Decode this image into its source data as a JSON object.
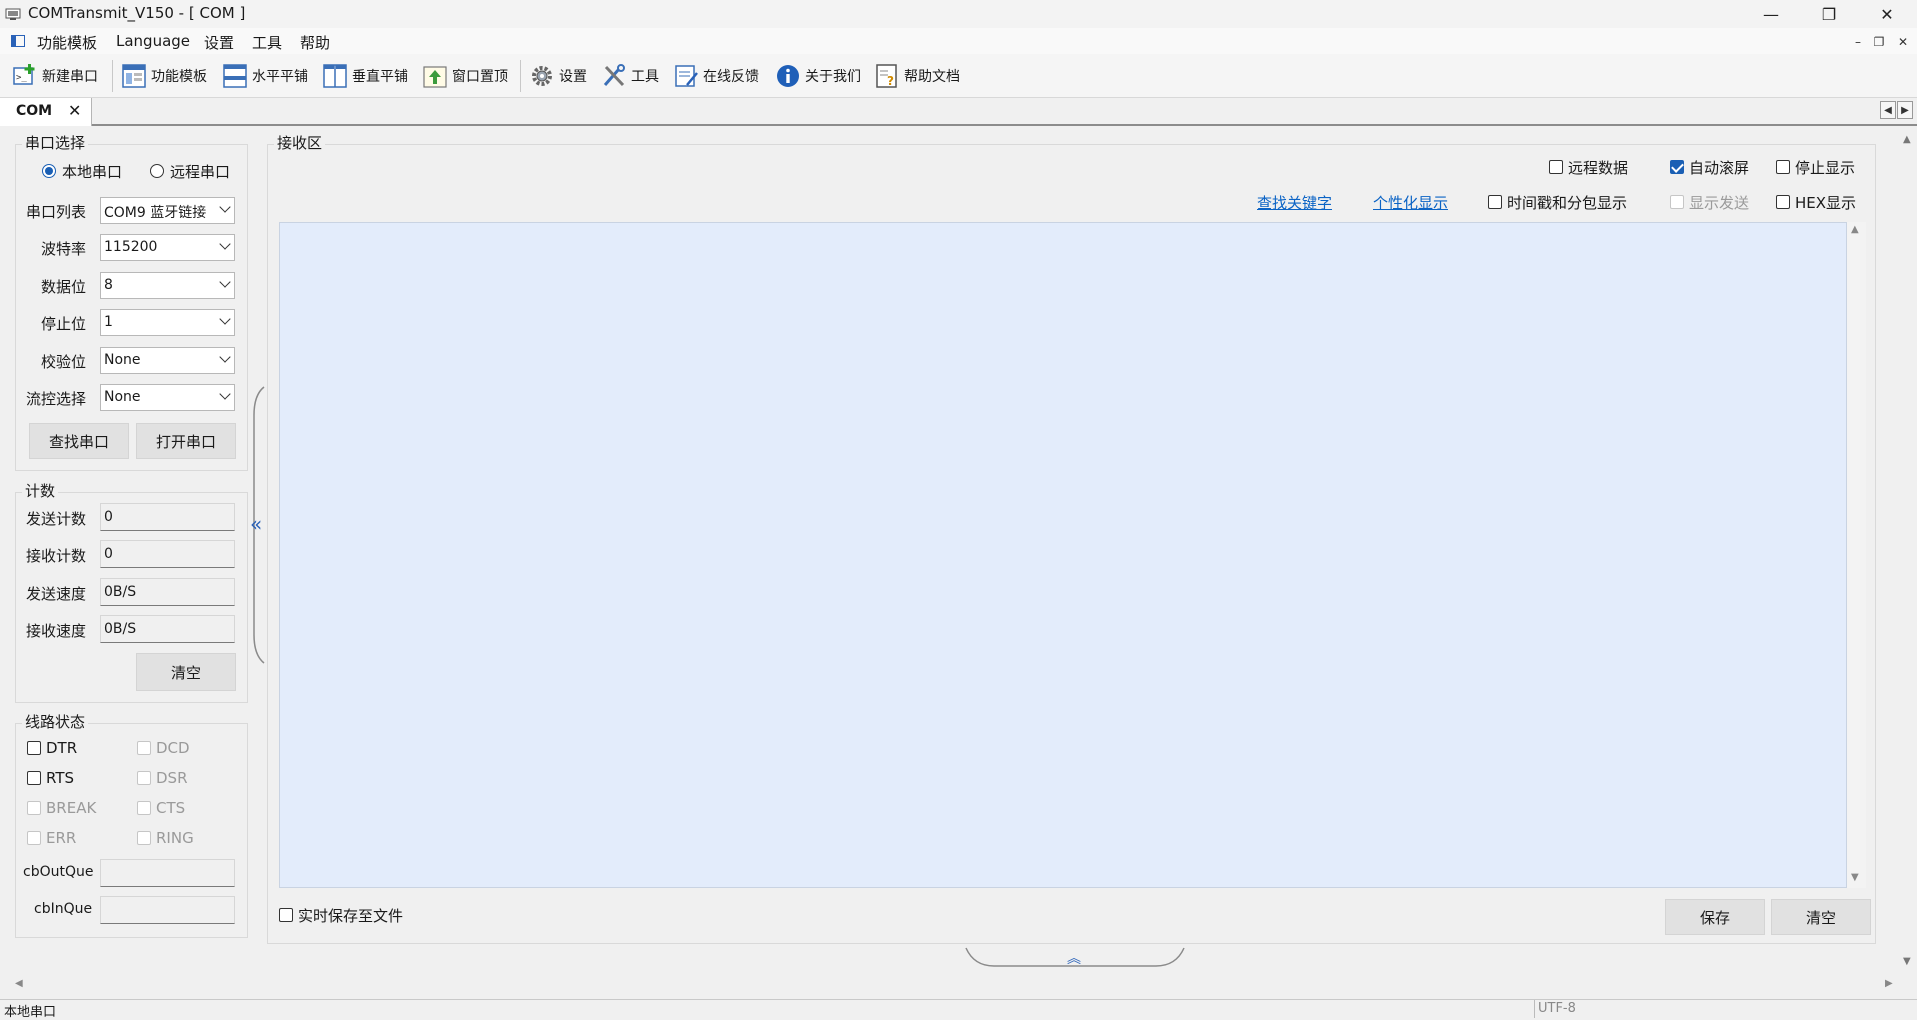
{
  "window": {
    "title": "COMTransmit_V150 - [  COM  ]"
  },
  "menu": [
    "功能模板",
    "Language",
    "设置",
    "工具",
    "帮助"
  ],
  "toolbar": [
    "新建串口",
    "功能模板",
    "水平平铺",
    "垂直平铺",
    "窗口置顶",
    "设置",
    "工具",
    "在线反馈",
    "关于我们",
    "帮助文档"
  ],
  "tab": {
    "label": "COM"
  },
  "serial": {
    "group_title": "串口选择",
    "radio_local": "本地串口",
    "radio_remote": "远程串口",
    "port_label": "串口列表",
    "port_value": "COM9  蓝牙链接",
    "baud_label": "波特率",
    "baud_value": "115200",
    "data_label": "数据位",
    "data_value": "8",
    "stop_label": "停止位",
    "stop_value": "1",
    "parity_label": "校验位",
    "parity_value": "None",
    "flow_label": "流控选择",
    "flow_value": "None",
    "find_button": "查找串口",
    "open_button": "打开串口"
  },
  "count": {
    "group_title": "计数",
    "send_count_label": "发送计数",
    "send_count": "0",
    "recv_count_label": "接收计数",
    "recv_count": "0",
    "send_speed_label": "发送速度",
    "send_speed": "0B/S",
    "recv_speed_label": "接收速度",
    "recv_speed": "0B/S",
    "clear_button": "清空"
  },
  "line": {
    "group_title": "线路状态",
    "dtr": "DTR",
    "dcd": "DCD",
    "rts": "RTS",
    "dsr": "DSR",
    "break": "BREAK",
    "cts": "CTS",
    "err": "ERR",
    "ring": "RING",
    "cbout_label": "cbOutQue",
    "cbout_value": "",
    "cbin_label": "cbInQue",
    "cbin_value": ""
  },
  "receive": {
    "group_title": "接收区",
    "remote_data": "远程数据",
    "auto_scroll": "自动滚屏",
    "stop_display": "停止显示",
    "find_keyword": "查找关键字",
    "custom_display": "个性化显示",
    "timestamp": "时间戳和分包显示",
    "show_send": "显示发送",
    "hex_display": "HEX显示",
    "save_realtime": "实时保存至文件",
    "save_button": "保存",
    "clear_button": "清空"
  },
  "status": {
    "left": "本地串口",
    "encoding": "UTF-8"
  },
  "colors": {
    "accent": "#1a5fb4",
    "receive_bg": "#e3ecfb",
    "link": "#0b63c5"
  }
}
